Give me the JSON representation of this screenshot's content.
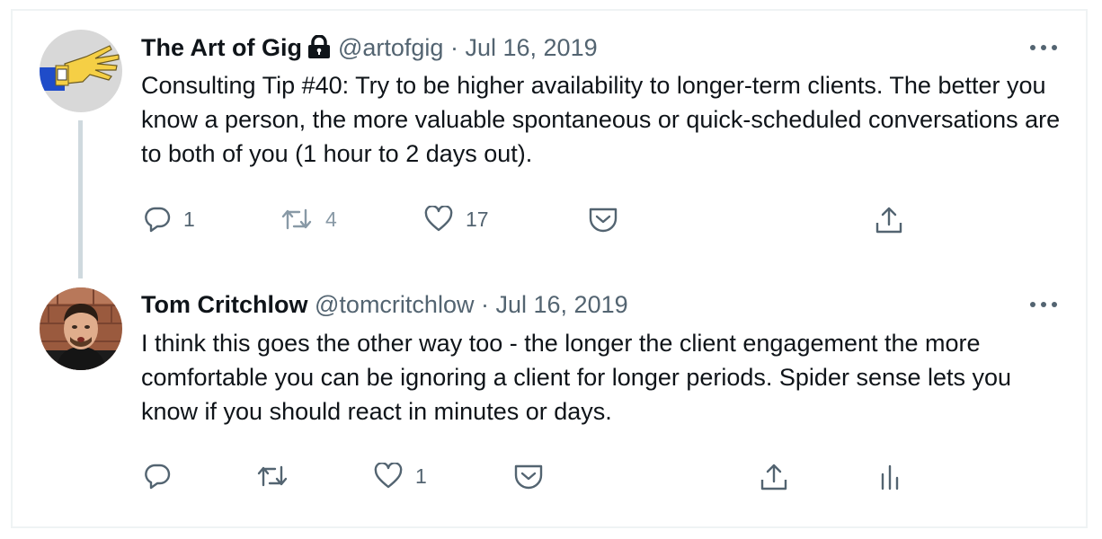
{
  "tweets": [
    {
      "author_name": "The Art of Gig",
      "handle": "@artofgig",
      "separator": "·",
      "date": "Jul 16, 2019",
      "text": "Consulting Tip #40: Try to be higher availability to longer-term clients. The better you know a person, the more valuable spontaneous or quick-scheduled conversations are to both of you (1 hour to 2 days out).",
      "reply_count": "1",
      "retweet_count": "4",
      "like_count": "17",
      "protected_icon": "lock-icon"
    },
    {
      "author_name": "Tom Critchlow",
      "handle": "@tomcritchlow",
      "separator": "·",
      "date": "Jul 16, 2019",
      "text": "I think this goes the other way too - the longer the client engagement the more comfortable you can be ignoring a client for longer periods. Spider sense lets you know if you should react in minutes or days.",
      "reply_count": "",
      "retweet_count": "",
      "like_count": "1"
    }
  ],
  "icons": [
    "reply-icon",
    "retweet-icon",
    "like-icon",
    "pocket-icon",
    "share-icon",
    "analytics-icon",
    "more-icon"
  ],
  "colors": {
    "text": "#0f1419",
    "secondary": "#536471",
    "thread_line": "#cfd9de",
    "border": "#eff3f4"
  }
}
